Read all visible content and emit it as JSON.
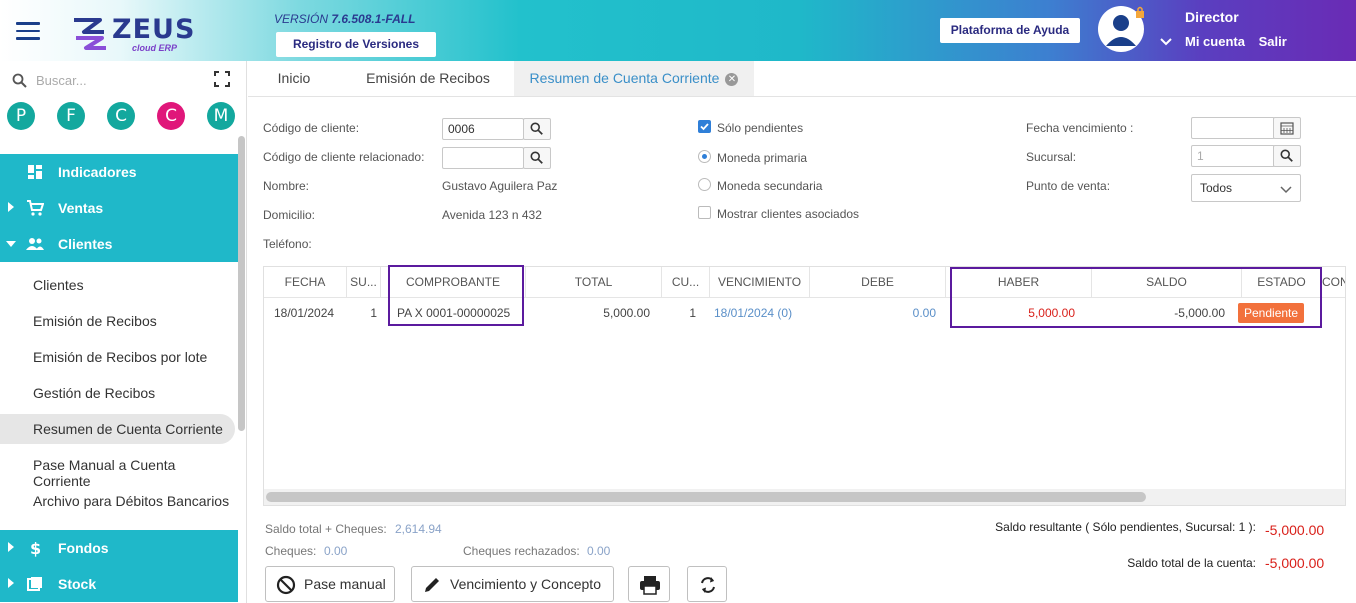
{
  "header": {
    "logo_text": "ZEUS",
    "logo_sub": "cloud ERP",
    "version_prefix": "VERSIÓN",
    "version_number": "7.6.508.1-FALL",
    "versions_button": "Registro de Versiones",
    "help_button": "Plataforma de Ayuda",
    "user_role": "Director",
    "account_link": "Mi cuenta",
    "logout_link": "Salir"
  },
  "sidebar": {
    "search_placeholder": "Buscar...",
    "shortcuts": [
      {
        "letter": "P",
        "color": "#13a89e"
      },
      {
        "letter": "F",
        "color": "#13a89e"
      },
      {
        "letter": "C",
        "color": "#13a89e"
      },
      {
        "letter": "C",
        "color": "#e0177a"
      },
      {
        "letter": "M",
        "color": "#13a89e"
      }
    ],
    "sections": {
      "indicadores": "Indicadores",
      "ventas": "Ventas",
      "clientes": "Clientes",
      "fondos": "Fondos",
      "stock": "Stock"
    },
    "clientes_items": [
      "Clientes",
      "Emisión de Recibos",
      "Emisión de Recibos por lote",
      "Gestión de Recibos",
      "Resumen de Cuenta Corriente",
      "Pase Manual a Cuenta Corriente",
      "Archivo para Débitos Bancarios"
    ]
  },
  "tabs": {
    "inicio": "Inicio",
    "emision": "Emisión de Recibos",
    "resumen": "Resumen de Cuenta Corriente"
  },
  "form": {
    "codigo_cliente_label": "Código de cliente:",
    "codigo_cliente_value": "0006",
    "codigo_relacionado_label": "Código de cliente relacionado:",
    "codigo_relacionado_value": "",
    "nombre_label": "Nombre:",
    "nombre_value": "Gustavo Aguilera Paz",
    "domicilio_label": "Domicilio:",
    "domicilio_value": "Avenida 123 n 432",
    "telefono_label": "Teléfono:",
    "solo_pendientes": "Sólo pendientes",
    "moneda_primaria": "Moneda primaria",
    "moneda_secundaria": "Moneda secundaria",
    "mostrar_asociados": "Mostrar clientes asociados",
    "fecha_venc_label": "Fecha vencimiento :",
    "sucursal_label": "Sucursal:",
    "sucursal_value": "1",
    "punto_venta_label": "Punto de venta:",
    "punto_venta_value": "Todos"
  },
  "grid": {
    "headers": {
      "fecha": "FECHA",
      "su": "SU...",
      "comprobante": "COMPROBANTE",
      "total": "TOTAL",
      "cu": "CU...",
      "vencimiento": "VENCIMIENTO",
      "debe": "DEBE",
      "haber": "HABER",
      "saldo": "SALDO",
      "estado": "ESTADO",
      "con": "CON"
    },
    "rows": [
      {
        "fecha": "18/01/2024",
        "su": "1",
        "comprobante": "PA X 0001-00000025",
        "total": "5,000.00",
        "cu": "1",
        "vencimiento": "18/01/2024 (0)",
        "debe": "0.00",
        "haber": "5,000.00",
        "saldo": "-5,000.00",
        "estado": "Pendiente"
      }
    ]
  },
  "footer": {
    "saldo_cheques_label": "Saldo total + Cheques:",
    "saldo_cheques_value": "2,614.94",
    "cheques_label": "Cheques:",
    "cheques_value": "0.00",
    "cheques_rech_label": "Cheques rechazados:",
    "cheques_rech_value": "0.00",
    "saldo_resultante_label": "Saldo resultante ( Sólo pendientes, Sucursal: 1 ):",
    "saldo_resultante_value": "-5,000.00",
    "saldo_cuenta_label": "Saldo total de la cuenta:",
    "saldo_cuenta_value": "-5,000.00",
    "pase_manual_button": "Pase manual",
    "vencimiento_button": "Vencimiento y Concepto"
  },
  "colors": {
    "accent": "#1fb8c9",
    "highlight": "#5b1a9e",
    "negative": "#d9201a",
    "badge": "#f2713c"
  }
}
